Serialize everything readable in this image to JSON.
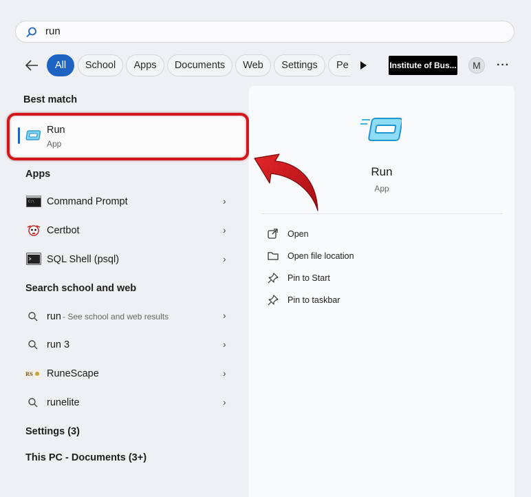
{
  "search": {
    "value": "run"
  },
  "filters": {
    "items": [
      "All",
      "School",
      "Apps",
      "Documents",
      "Web",
      "Settings",
      "Pe"
    ],
    "active": "All",
    "org_badge": "Institute of Bus...",
    "avatar_initial": "M",
    "more": "···"
  },
  "left": {
    "best_match_heading": "Best match",
    "best_match": {
      "title": "Run",
      "subtitle": "App"
    },
    "apps_heading": "Apps",
    "apps": [
      {
        "label": "Command Prompt",
        "icon": "command-prompt-icon"
      },
      {
        "label": "Certbot",
        "icon": "certbot-icon"
      },
      {
        "label": "SQL Shell (psql)",
        "icon": "sql-shell-icon"
      }
    ],
    "web_heading": "Search school and web",
    "web": [
      {
        "label": "run",
        "suffix": " - See school and web results",
        "icon": "search-icon"
      },
      {
        "label": "run 3",
        "suffix": "",
        "icon": "search-icon"
      },
      {
        "label": "RuneScape",
        "suffix": "",
        "icon": "runescape-icon"
      },
      {
        "label": "runelite",
        "suffix": "",
        "icon": "search-icon"
      }
    ],
    "settings_heading": "Settings (3)",
    "documents_heading": "This PC - Documents (3+)"
  },
  "right": {
    "title": "Run",
    "subtitle": "App",
    "actions": [
      {
        "label": "Open",
        "icon": "open-external-icon"
      },
      {
        "label": "Open file location",
        "icon": "folder-icon"
      },
      {
        "label": "Pin to Start",
        "icon": "pin-icon"
      },
      {
        "label": "Pin to taskbar",
        "icon": "pin-icon"
      }
    ]
  },
  "colors": {
    "accent": "#1e63c2",
    "highlight_red": "#d2161b",
    "run_icon": "#35b4e6"
  }
}
